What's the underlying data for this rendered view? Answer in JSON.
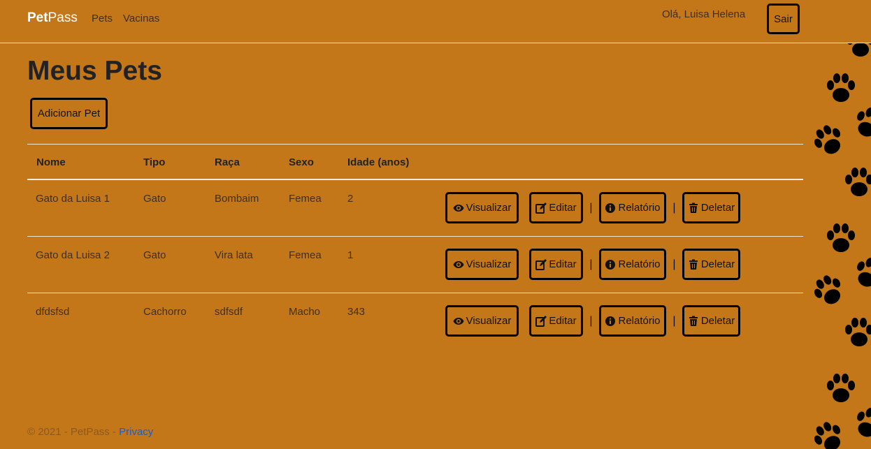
{
  "nav": {
    "brand_bold": "Pet",
    "brand_light": "Pass",
    "links": [
      "Pets",
      "Vacinas"
    ],
    "greeting": "Olá, Luisa Helena",
    "logout_label": "Sair"
  },
  "page": {
    "title": "Meus Pets",
    "add_label": "Adicionar Pet"
  },
  "table": {
    "headers": [
      "Nome",
      "Tipo",
      "Raça",
      "Sexo",
      "Idade (anos)"
    ],
    "actions": {
      "view": "Visualizar",
      "edit": "Editar",
      "report": "Relatório",
      "delete": "Deletar",
      "separator": "|"
    },
    "rows": [
      [
        "Gato da Luisa 1",
        "Gato",
        "Bombaim",
        "Femea",
        "2"
      ],
      [
        "Gato da Luisa 2",
        "Gato",
        "Vira lata",
        "Femea",
        "1"
      ],
      [
        "dfdsfsd",
        "Cachorro",
        "sdfsdf",
        "Macho",
        "343"
      ]
    ]
  },
  "footer": {
    "text": "© 2021 - PetPass - ",
    "link": "Privacy"
  },
  "icons": {
    "view": "eye-icon",
    "edit": "edit-icon",
    "report": "info-icon",
    "delete": "trash-icon",
    "decor": "paw-print-icon"
  },
  "colors": {
    "background": "#c37719",
    "border": "#000000",
    "link": "#1a5fc8"
  }
}
